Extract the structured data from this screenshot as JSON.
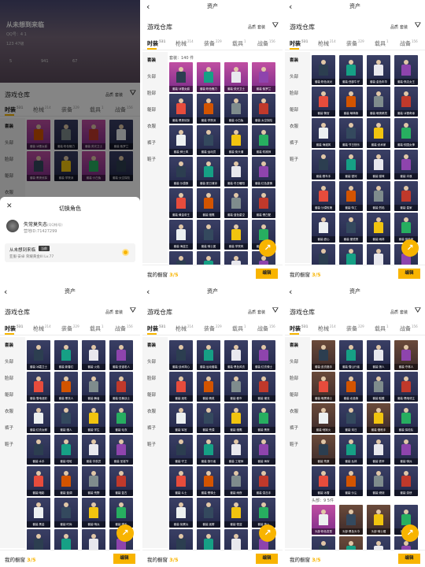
{
  "common": {
    "title": "资产",
    "warehouse": "游戏仓库",
    "filter_quality": "品质",
    "filter_type": "套装",
    "tabs": [
      {
        "label": "时装",
        "count": "531"
      },
      {
        "label": "枪械",
        "count": "214"
      },
      {
        "label": "装备",
        "count": "229"
      },
      {
        "label": "载具",
        "count": "1"
      },
      {
        "label": "战备",
        "count": "156"
      }
    ],
    "side": [
      "套装",
      "头部",
      "脸部",
      "躯部",
      "衣服",
      "裤子",
      "鞋子"
    ],
    "wardrobe_label": "我的橱窗",
    "wardrobe_count": "3/5",
    "edit": "编辑",
    "set_section": "套装：140 件",
    "head_section": "头部：9 5件",
    "more": "更多"
  },
  "switch": {
    "bg_name": "从未想到来临",
    "bg_sub1": "QQ号：4 1",
    "bg_sub2": "123 47级",
    "bg_stats": [
      "5",
      "941",
      "67"
    ],
    "title": "切换角色",
    "user": "失常莫失态",
    "user_tag": "(QQ帐号)",
    "user_id": "营地ID:71427299",
    "role": "从未想到来临",
    "badge": "当前",
    "role_sub": "亚服·安卓  荣耀黄金III  Lv.77"
  },
  "captions": {
    "p2": [
      "套装·冰雪女爵",
      "套装·粉色魅力",
      "套装·荧光卫士",
      "套装·紫罗兰",
      "套装·黑夜侦探",
      "套装·学院派",
      "套装·小白兔",
      "套装·太空探险",
      "套装·绅士风",
      "套装·运动员",
      "套装·街头潮",
      "套装·机械师",
      "套装·沙漠狼",
      "套装·夏日清凉",
      "套装·冬日暖阳",
      "套装·红色激情",
      "套装·黄金帝王",
      "套装·猎鹰",
      "套装·蓝色星空",
      "套装·黑白配",
      "套装·海盗王",
      "套装·骑士团",
      "套装·学院风",
      "套装·狂欢节",
      "套装·少女心",
      "套装·都市丽人",
      "套装·夜行者",
      "套装·特种兵"
    ],
    "p3": [
      "套装·粉色派对",
      "套装·西部牛仔",
      "套装·金色年华",
      "套装·夜店女王",
      "套装·警官",
      "套装·萌萌熊",
      "套装·暗夜精灵",
      "套装·冰雪奇缘",
      "套装·海滩风",
      "套装·节日快乐",
      "套装·武术家",
      "套装·校园女神",
      "套装·赛车手",
      "套装·银河",
      "套装·猫咪",
      "套装·冲浪",
      "套装·沙漠玫瑰",
      "套装·特工",
      "套装·烈焰",
      "套装·皇家",
      "套装·甜心",
      "套装·墨镜男",
      "套装·雨林",
      "套装·探险家",
      "套装·摇滚",
      "套装·医生",
      "套装·忍者",
      "套装·魔法"
    ],
    "p4": [
      "套装·冰霜卫士",
      "套装·新春红",
      "套装·火焰",
      "套装·圣诞老人",
      "套装·雪地迷彩",
      "套装·黑衣人",
      "套装·舞者",
      "套装·狂暴战士",
      "套装·红衣女郎",
      "套装·猎人",
      "套装·学生",
      "套装·毛衣",
      "套装·水手",
      "套装·嘻哈",
      "套装·宇航员",
      "套装·圣诞节",
      "套装·暗影",
      "套装·蓝调",
      "套装·荒野",
      "套装·复古",
      "套装·黑金",
      "套装·时尚",
      "套装·哨兵",
      "套装·猎手",
      "套装·小丑",
      "套装·野战",
      "套装·冬装",
      "套装·运动"
    ],
    "p5": [
      "套装·战术背心",
      "套装·运动套装",
      "套装·黑色风衣",
      "套装·红衣骑士",
      "套装·迷彩",
      "套装·精英",
      "套装·都市",
      "套装·潮流",
      "套装·军官",
      "套装·荒漠",
      "套装·猎鹰",
      "套装·黑夜",
      "套装·守卫",
      "套装·旅行者",
      "套装·工程师",
      "套装·海军",
      "套装·斗士",
      "套装·黑骑士",
      "套装·雨夜",
      "套装·突击手",
      "套装·侦察兵",
      "套装·迷雾",
      "套装·怪盗",
      "套装·旅人",
      "套装·大侠",
      "套装·剑客",
      "套装·学霸",
      "套装·浪人"
    ],
    "p6": [
      "套装·皮衣猎手",
      "套装·雪山行者",
      "套装·狼人",
      "套装·守林人",
      "套装·暗黑骑士",
      "套装·北极熊",
      "套装·骷髅",
      "套装·黑暗领主",
      "套装·地狱火",
      "套装·末日",
      "套装·猎枪手",
      "套装·探险队",
      "套装·荒原",
      "套装·丛林",
      "套装·铁甲",
      "套装·骑兵",
      "套装·冰雪",
      "套装·沙尘",
      "套装·燃烧",
      "套装·游侠",
      "头部·粉色发型",
      "头部·黑色头巾",
      "头部·骑士帽",
      "头部·猫耳",
      "头部·蓝色帽",
      "头部·棒球帽",
      "头部·战术头盔",
      "头部·毛线帽"
    ]
  },
  "colors": {
    "accent": "#f8b400",
    "tile": "#2a2f52",
    "tile_pink": "#c04fa2"
  }
}
